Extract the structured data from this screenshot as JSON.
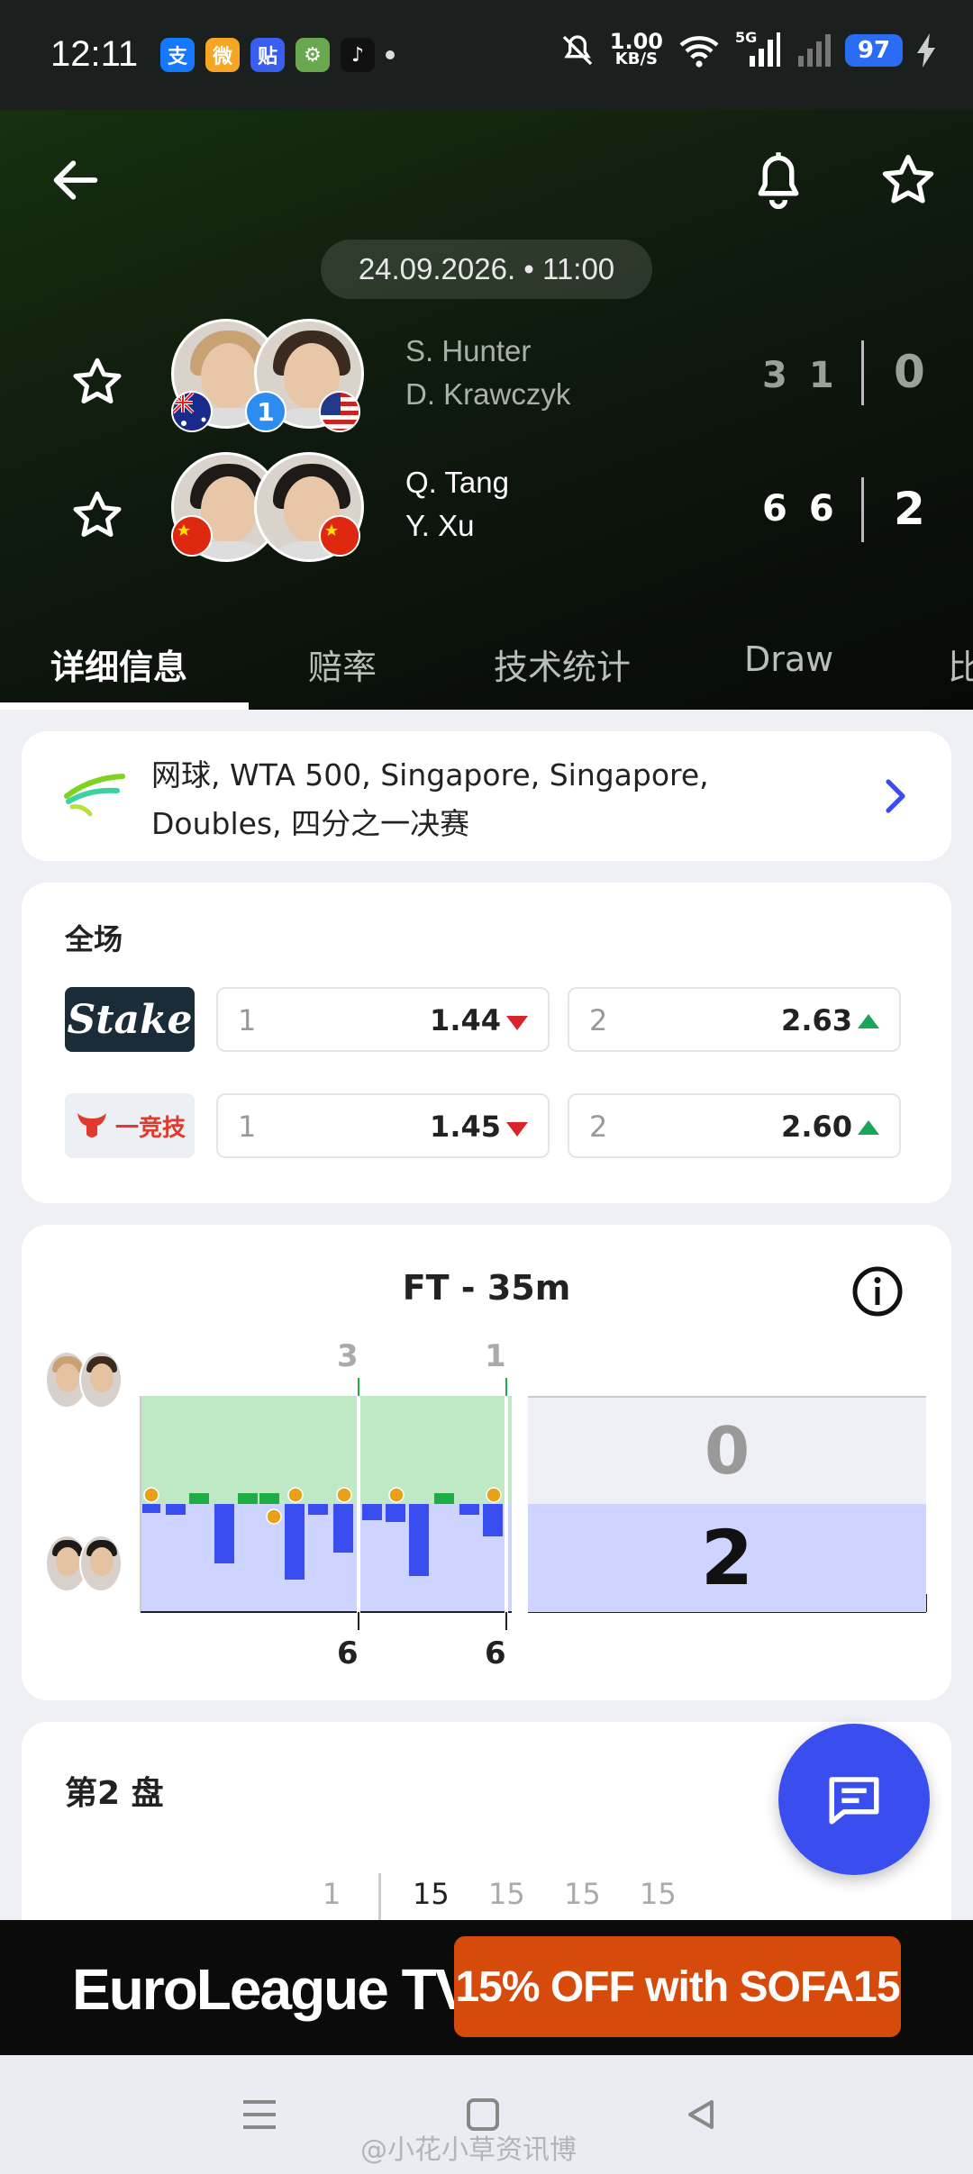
{
  "status_bar": {
    "time": "12:11",
    "apps": [
      {
        "icon": "alipay-icon",
        "glyph": "支",
        "color": "#1677ff"
      },
      {
        "icon": "weibo-icon",
        "glyph": "微",
        "color": "#f5a623"
      },
      {
        "icon": "tieba-icon",
        "glyph": "贴",
        "color": "#3a5ef0"
      },
      {
        "icon": "game-app-icon",
        "glyph": "⚙",
        "color": "#6aa84f"
      },
      {
        "icon": "tiktok-icon",
        "glyph": "♪",
        "color": "#111111"
      }
    ],
    "net_speed_value": "1.00",
    "net_speed_unit": "KB/S",
    "network": "5G",
    "battery": "97"
  },
  "header": {
    "date_time": "24.09.2026. • 11:00",
    "teams": [
      {
        "player1": "S. Hunter",
        "player2": "D. Krawczyk",
        "seed": "1",
        "set_scores": [
          "3",
          "1"
        ],
        "sets_won": "0",
        "flags": [
          "australia-flag-icon",
          "usa-flag-icon"
        ]
      },
      {
        "player1": "Q. Tang",
        "player2": "Y. Xu",
        "seed": "",
        "set_scores": [
          "6",
          "6"
        ],
        "sets_won": "2",
        "flags": [
          "china-flag-icon",
          "china-flag-icon"
        ]
      }
    ],
    "tabs": [
      "详细信息",
      "赔率",
      "技术统计",
      "Draw",
      "比"
    ],
    "active_tab": 0
  },
  "league": {
    "line1": "网球, WTA 500, Singapore, Singapore,",
    "line2": "Doubles, 四分之一决赛"
  },
  "odds": {
    "title": "全场",
    "bookmakers": [
      {
        "name": "Stake",
        "home_label": "1",
        "home_odds": "1.44",
        "home_trend": "down",
        "away_label": "2",
        "away_odds": "2.63",
        "away_trend": "up"
      },
      {
        "name": "一竞技",
        "home_label": "1",
        "home_odds": "1.45",
        "home_trend": "down",
        "away_label": "2",
        "away_odds": "2.60",
        "away_trend": "up"
      }
    ]
  },
  "momentum": {
    "title": "FT - 35m",
    "set_labels_top": [
      "3",
      "1"
    ],
    "set_labels_bottom": [
      "6",
      "6"
    ],
    "sets_top": "0",
    "sets_bottom": "2",
    "colors": {
      "top_area": "#bfe8c4",
      "bottom_area": "#cdd4ff",
      "top_bar": "#1fae45",
      "bottom_bar": "#3a4ef0",
      "break_marker": "#e8a21a"
    }
  },
  "set2": {
    "title": "第2 盘",
    "points_row": [
      "1",
      "15",
      "15",
      "15",
      "15"
    ]
  },
  "ad": {
    "brand": "EuroLeague TV",
    "cta": "15% OFF with SOFA15"
  },
  "watermark": "@小花小草资讯博"
}
